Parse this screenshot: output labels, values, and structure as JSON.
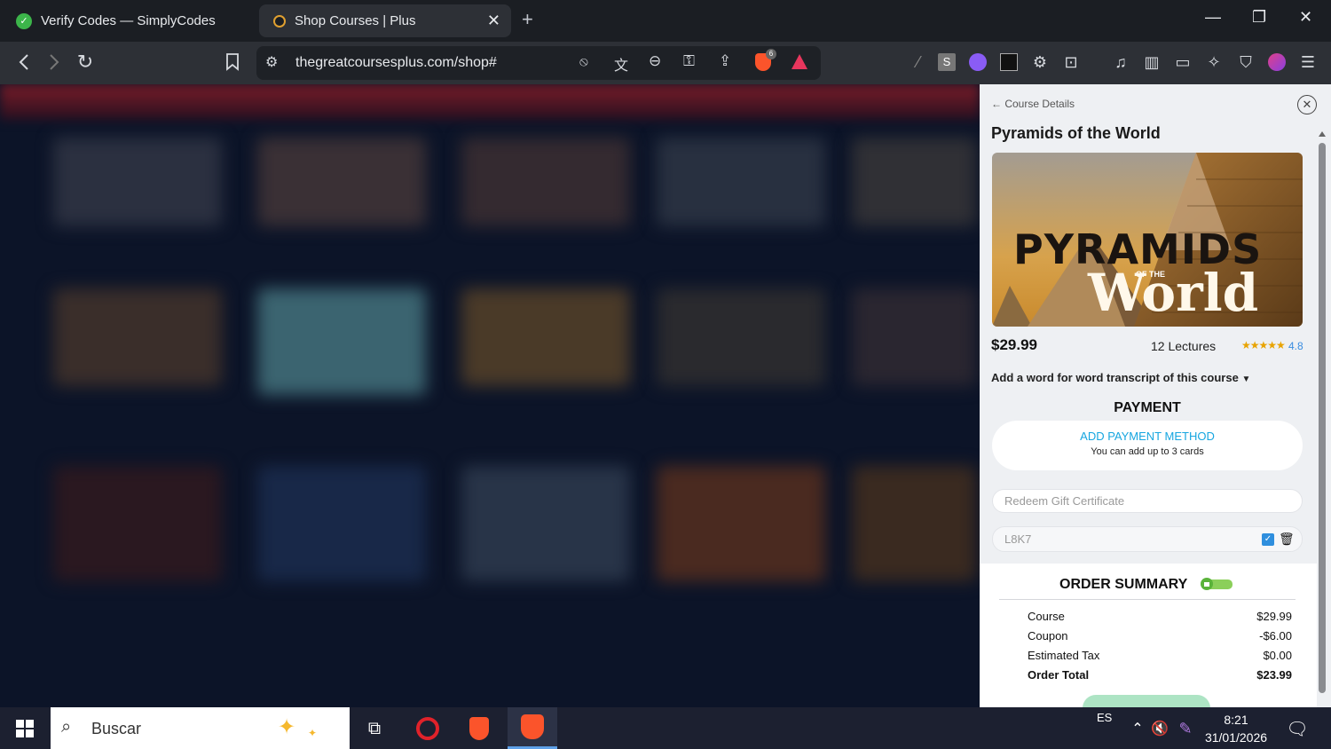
{
  "browser": {
    "tabs": [
      {
        "title": "Verify Codes — SimplyCodes",
        "active": false
      },
      {
        "title": "Shop Courses | Plus",
        "active": true
      }
    ],
    "url": "thegreatcoursesplus.com/shop#",
    "brave_badge": "6"
  },
  "panel": {
    "back_label": "Course Details",
    "course_title": "Pyramids of the World",
    "image_text": {
      "line1": "PYRAMIDS",
      "line2": "OF THE",
      "line3": "World"
    },
    "price": "$29.99",
    "lectures": "12 Lectures",
    "stars": "★★★★★",
    "rating": "4.8",
    "transcript_label": "Add a word for word transcript of this course",
    "payment_heading": "PAYMENT",
    "add_payment_label": "ADD PAYMENT METHOD",
    "add_payment_sub": "You can add up to 3 cards",
    "gift_placeholder": "Redeem Gift Certificate",
    "coupon_value": "L8K7",
    "summary_heading": "ORDER SUMMARY",
    "summary_rows": [
      {
        "label": "Course",
        "value": "$29.99"
      },
      {
        "label": "Coupon",
        "value": "-$6.00"
      },
      {
        "label": "Estimated Tax",
        "value": "$0.00"
      },
      {
        "label": "Order Total",
        "value": "$23.99"
      }
    ]
  },
  "taskbar": {
    "search_placeholder": "Buscar",
    "language": "ES",
    "time": "8:21",
    "date": "31/01/2026"
  },
  "colors": {
    "accent_blue": "#17a6e0",
    "confirm_green": "#5cc98a",
    "tab_strip": "#1b1e23",
    "toolbar": "#2d3036"
  }
}
